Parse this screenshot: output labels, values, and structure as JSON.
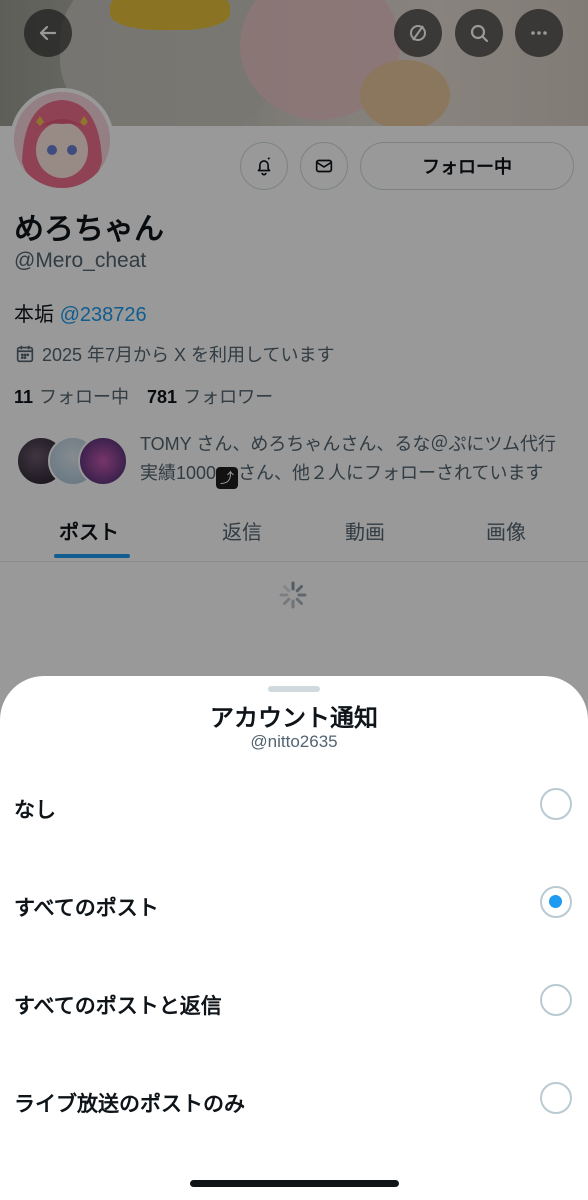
{
  "profile": {
    "display_name": "めろちゃん",
    "handle": "@Mero_cheat",
    "bio_prefix": "本垢",
    "bio_mention": "@238726",
    "joined": "2025 年7月から X を利用しています",
    "following_count": "11",
    "following_label": "フォロー中",
    "followers_count": "781",
    "followers_label": "フォロワー",
    "followed_by_text_1": "TOMY さん、めろちゃんさん、るな＠ぷにツム代行",
    "followed_by_text_2a": "実績1000",
    "followed_by_text_2b": "さん、他２人にフォローされています",
    "follow_button_label": "フォロー中"
  },
  "tabs": [
    {
      "label": "ポスト",
      "active": true
    },
    {
      "label": "返信",
      "active": false
    },
    {
      "label": "動画",
      "active": false
    },
    {
      "label": "画像",
      "active": false
    }
  ],
  "sheet": {
    "title": "アカウント通知",
    "subtitle": "@nitto2635",
    "options": [
      {
        "label": "なし",
        "selected": false
      },
      {
        "label": "すべてのポスト",
        "selected": true
      },
      {
        "label": "すべてのポストと返信",
        "selected": false
      },
      {
        "label": "ライブ放送のポストのみ",
        "selected": false
      }
    ]
  },
  "colors": {
    "accent": "#1d9bf0",
    "text_primary": "#0f1419",
    "text_secondary": "#536471"
  },
  "icons": {
    "back": "arrow-left-icon",
    "no_wifi": "circle-slash-icon",
    "search": "search-icon",
    "more": "more-horizontal-icon",
    "notify": "bell-icon",
    "message": "mail-icon",
    "calendar": "calendar-icon"
  }
}
